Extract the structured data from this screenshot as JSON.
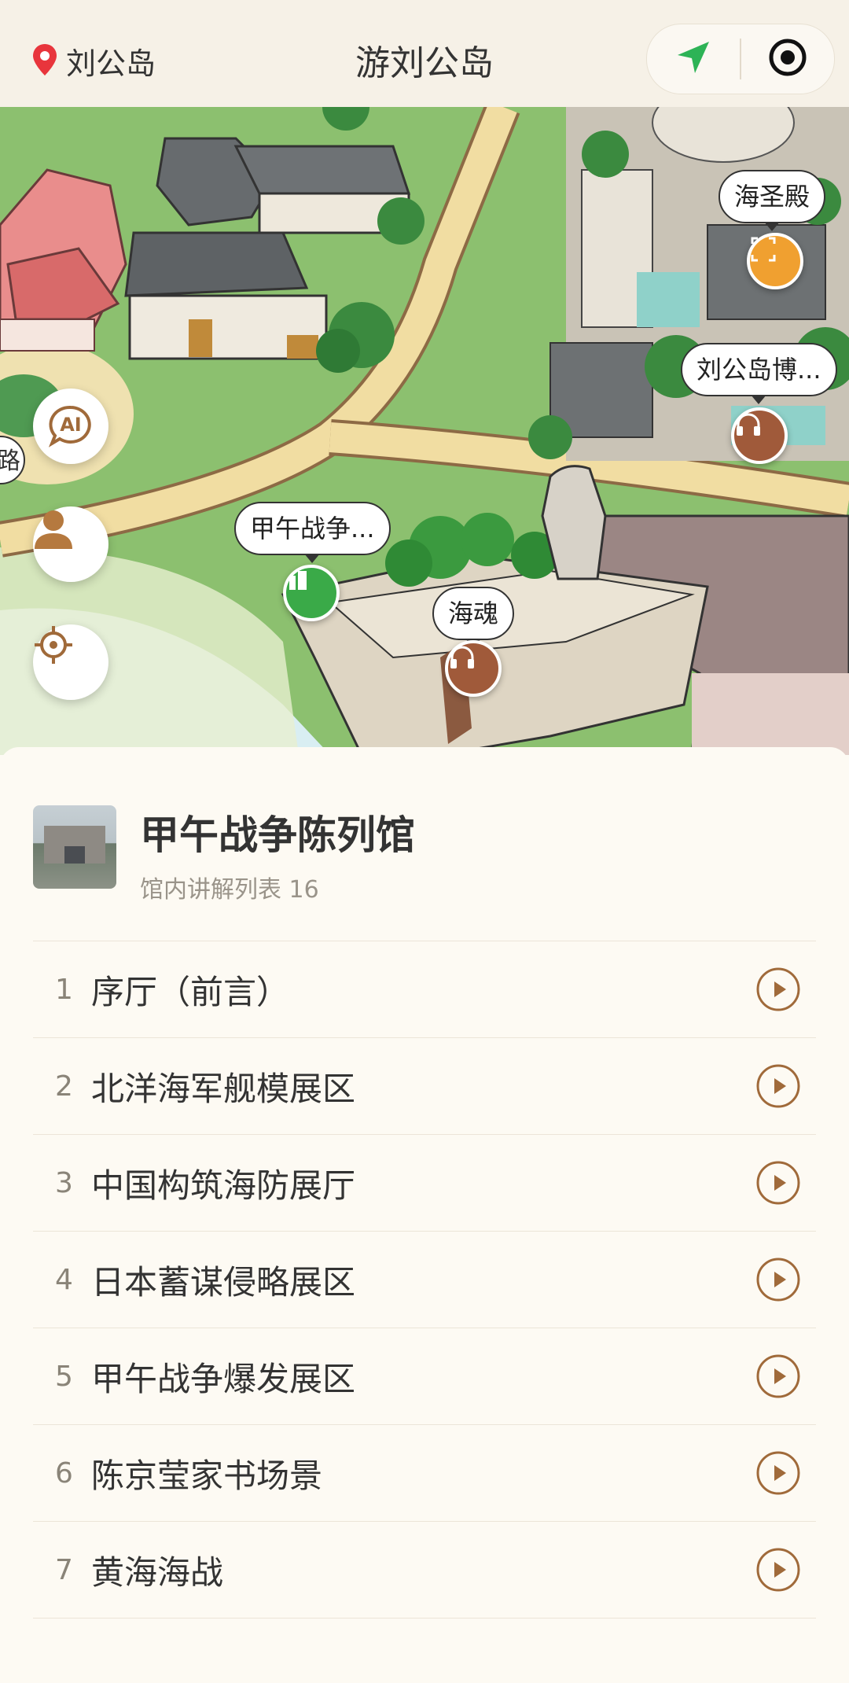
{
  "header": {
    "location_label": "刘公岛",
    "title": "游刘公岛",
    "navigate_icon": "navigate-arrow-icon",
    "record_icon": "target-circle-icon"
  },
  "map": {
    "callouts": {
      "haishengdian": "海圣殿",
      "museum": "刘公岛博...",
      "jiawu": "甲午战争...",
      "haihun": "海魂",
      "edge": "路"
    },
    "side_buttons": [
      "ai-icon",
      "user-avatar-icon",
      "locate-crosshair-icon"
    ],
    "ai_label": "AI"
  },
  "panel": {
    "exhibit_name": "甲午战争陈列馆",
    "exhibit_sub": "馆内讲解列表 16",
    "items": [
      {
        "num": "1",
        "label": "序厅（前言）"
      },
      {
        "num": "2",
        "label": "北洋海军舰模展区"
      },
      {
        "num": "3",
        "label": "中国构筑海防展厅"
      },
      {
        "num": "4",
        "label": "日本蓄谋侵略展区"
      },
      {
        "num": "5",
        "label": "甲午战争爆发展区"
      },
      {
        "num": "6",
        "label": "陈京莹家书场景"
      },
      {
        "num": "7",
        "label": "黄海海战"
      }
    ]
  },
  "colors": {
    "accent_brown": "#a06a3a",
    "pin_orange": "#f0a030",
    "pin_green": "#3aaa48",
    "nav_green": "#2db356",
    "location_red": "#e8353c"
  }
}
